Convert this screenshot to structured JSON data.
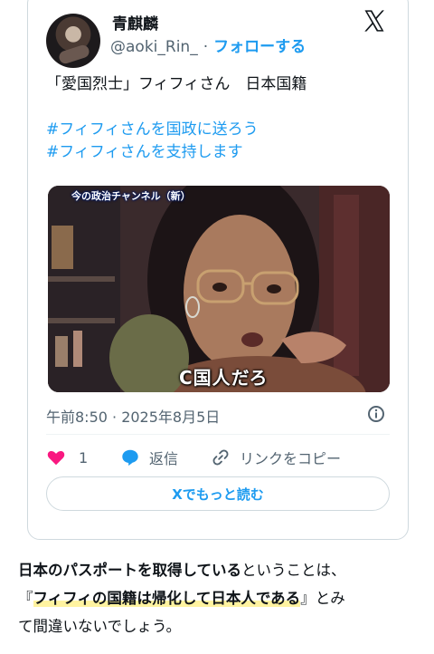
{
  "tweet": {
    "display_name": "青麒麟",
    "handle": "@aoki_Rin_",
    "separator": "·",
    "follow_label": "フォローする",
    "text_line1": "「愛国烈士」フィフィさん　日本国籍",
    "hashtag1": "#フィフィさんを国政に送ろう",
    "hashtag2": "#フィフィさんを支持します",
    "media": {
      "channel_label": "今の政治チャンネル（新）",
      "subtitle": "C国人だろ"
    },
    "timestamp": "午前8:50 · 2025年8月5日",
    "like_count": "1",
    "reply_label": "返信",
    "copy_link_label": "リンクをコピー",
    "read_more_label": "Xでもっと読む"
  },
  "article": {
    "line1_bold": "日本のパスポートを取得している",
    "line1_rest": "ということは、",
    "line2_open": "『",
    "line2_highlight": "フィフィの国籍は帰化して日本人である",
    "line2_close": "』とみ",
    "line3": "て間違いないでしょう。"
  },
  "colors": {
    "accent": "#1d9bf0",
    "like": "#f91880",
    "muted": "#536471",
    "highlight": "#fff3a0"
  },
  "icons": [
    "x-logo-icon",
    "info-icon",
    "heart-icon",
    "reply-bubble-icon",
    "link-icon"
  ]
}
